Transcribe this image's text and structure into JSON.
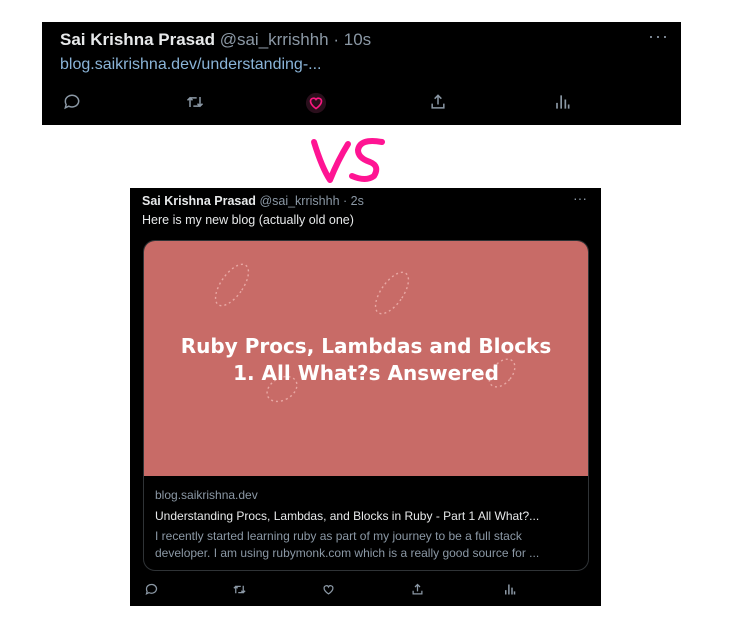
{
  "top_tweet": {
    "name": "Sai Krishna Prasad",
    "handle": "@sai_krrishhh",
    "separator": "·",
    "time": "10s",
    "link": "blog.saikrishna.dev/understanding-...",
    "more": "···",
    "actions": [
      "reply-icon",
      "retweet-icon",
      "like-icon",
      "share-icon",
      "analytics-icon"
    ],
    "like_color": "#f91880"
  },
  "vs_label": "VS",
  "vs_color": "#ff1493",
  "bottom_tweet": {
    "name": "Sai Krishna Prasad",
    "handle": "@sai_krrishhh",
    "separator": "·",
    "time": "2s",
    "more": "···",
    "text": "Here is my new blog (actually old one)",
    "card": {
      "image_title_line1": "Ruby Procs, Lambdas and Blocks",
      "image_title_line2": "1. All What?s Answered",
      "image_bg": "#c86b67",
      "domain": "blog.saikrishna.dev",
      "title": "Understanding Procs, Lambdas, and Blocks in Ruby - Part 1 All What?...",
      "description": "I recently started learning ruby as part of my journey to be a full stack developer. I am using rubymonk.com which is a really good source for ..."
    },
    "actions": [
      "reply-icon",
      "retweet-icon",
      "like-icon",
      "share-icon",
      "analytics-icon"
    ]
  }
}
